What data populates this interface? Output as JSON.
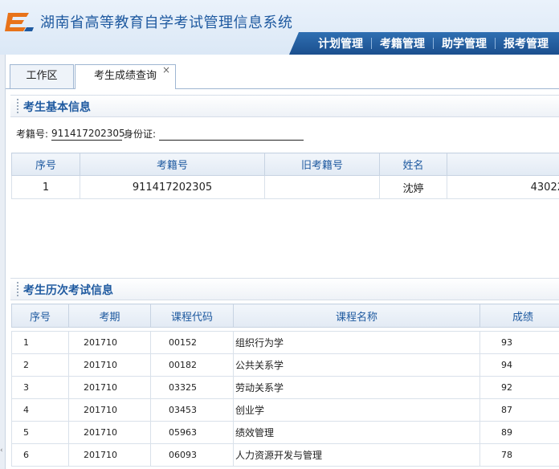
{
  "app": {
    "title": "湖南省高等教育自学考试管理信息系统"
  },
  "nav": [
    "计划管理",
    "考籍管理",
    "助学管理",
    "报考管理"
  ],
  "tabs": [
    {
      "label": "工作区"
    },
    {
      "label": "考生成绩查询",
      "close": "×"
    }
  ],
  "basic": {
    "section_title": "考生基本信息",
    "exam_no_label": "考籍号:",
    "exam_no_value": "911417202305",
    "id_label": "身份证:",
    "id_value": "",
    "columns": [
      "序号",
      "考籍号",
      "旧考籍号",
      "姓名",
      ""
    ],
    "rows": [
      {
        "seq": "1",
        "exam_no": "911417202305",
        "old_exam_no": "",
        "name": "沈婷",
        "id_card": "43022"
      }
    ]
  },
  "history": {
    "section_title": "考生历次考试信息",
    "columns": [
      "序号",
      "考期",
      "课程代码",
      "课程名称",
      "成绩"
    ],
    "rows": [
      {
        "seq": "1",
        "period": "201710",
        "code": "00152",
        "course": "组织行为学",
        "score": "93"
      },
      {
        "seq": "2",
        "period": "201710",
        "code": "00182",
        "course": "公共关系学",
        "score": "94"
      },
      {
        "seq": "3",
        "period": "201710",
        "code": "03325",
        "course": "劳动关系学",
        "score": "92"
      },
      {
        "seq": "4",
        "period": "201710",
        "code": "03453",
        "course": "创业学",
        "score": "87"
      },
      {
        "seq": "5",
        "period": "201710",
        "code": "05963",
        "course": "绩效管理",
        "score": "89"
      },
      {
        "seq": "6",
        "period": "201710",
        "code": "06093",
        "course": "人力资源开发与管理",
        "score": "78"
      }
    ]
  },
  "colors": {
    "brand": "#1f5aa0",
    "nav_bg": "#1b4f8e",
    "logo_orange": "#e8731a"
  }
}
